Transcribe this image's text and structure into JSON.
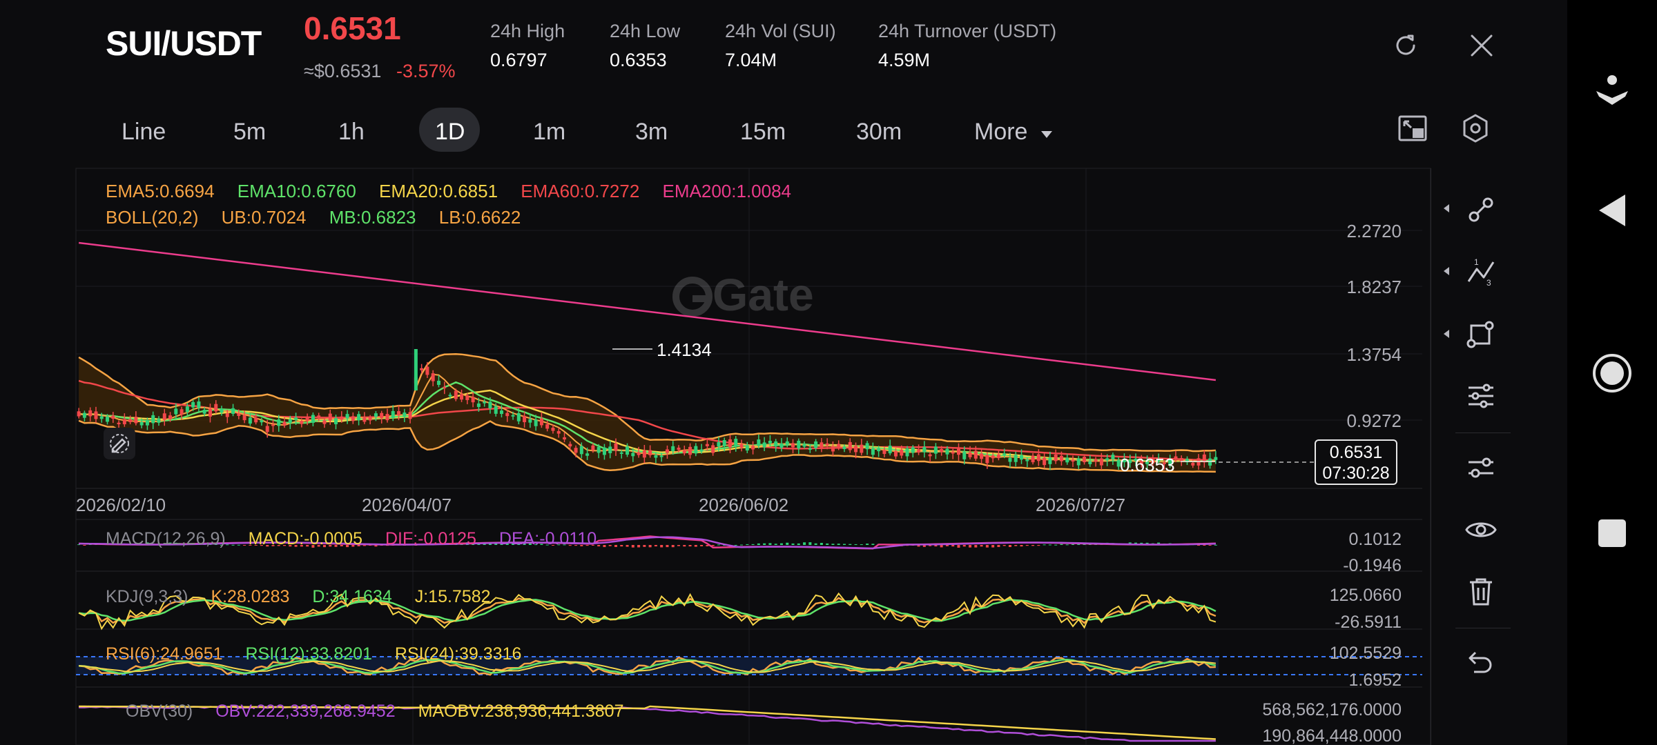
{
  "header": {
    "pair": "SUI/USDT",
    "last_price": "0.6531",
    "usd_price": "≈$0.6531",
    "change": "-3.57%",
    "stats": [
      {
        "label": "24h   High",
        "value": "0.6797"
      },
      {
        "label": "24h   Low",
        "value": "0.6353"
      },
      {
        "label": "24h   Vol (SUI)",
        "value": "7.04M"
      },
      {
        "label": "24h   Turnover (USDT)",
        "value": "4.59M"
      }
    ]
  },
  "timeframes": [
    "Line",
    "5m",
    "1h",
    "1D",
    "1m",
    "3m",
    "15m",
    "30m",
    "More"
  ],
  "active_timeframe": "1D",
  "indicators": {
    "ema": [
      {
        "text": "EMA5:0.6694",
        "color": "#f7a444"
      },
      {
        "text": "EMA10:0.6760",
        "color": "#5fe36a"
      },
      {
        "text": "EMA20:0.6851",
        "color": "#f5d54a"
      },
      {
        "text": "EMA60:0.7272",
        "color": "#f2474a"
      },
      {
        "text": "EMA200:1.0084",
        "color": "#ec3c8c"
      }
    ],
    "boll": [
      {
        "text": "BOLL(20,2)",
        "color": "#f7a444"
      },
      {
        "text": "UB:0.7024",
        "color": "#f7a444"
      },
      {
        "text": "MB:0.6823",
        "color": "#5fe36a"
      },
      {
        "text": "LB:0.6622",
        "color": "#f7a444"
      }
    ],
    "macd": [
      {
        "text": "MACD(12,26,9)",
        "color": "#8a8a92"
      },
      {
        "text": "MACD:-0.0005",
        "color": "#f5d54a"
      },
      {
        "text": "DIF:-0.0125",
        "color": "#ec3c8c"
      },
      {
        "text": "DEA:-0.0110",
        "color": "#b04fd9"
      }
    ],
    "kdj": [
      {
        "text": "KDJ(9,3,3)",
        "color": "#8a8a92"
      },
      {
        "text": "K:28.0283",
        "color": "#f7a444"
      },
      {
        "text": "D:34.1634",
        "color": "#5fe36a"
      },
      {
        "text": "J:15.7582",
        "color": "#f5d54a"
      }
    ],
    "rsi": [
      {
        "text": "RSI(6):24.9651",
        "color": "#f7a444"
      },
      {
        "text": "RSI(12):33.8201",
        "color": "#5fe36a"
      },
      {
        "text": "RSI(24):39.3316",
        "color": "#f5d54a"
      }
    ],
    "obv": [
      {
        "text": "OBV(30)",
        "color": "#8a8a92"
      },
      {
        "text": "OBV:222,339,268.9452",
        "color": "#b04fd9"
      },
      {
        "text": "MAOBV:238,936,441.3807",
        "color": "#f5d54a"
      }
    ]
  },
  "axes": {
    "main_y": [
      "2.2720",
      "1.8237",
      "1.3754",
      "0.9272"
    ],
    "x_dates": [
      "2026/02/10",
      "2026/04/07",
      "2026/06/02",
      "2026/07/27"
    ],
    "macd_y": [
      "0.1012",
      "-0.1946"
    ],
    "kdj_y": [
      "125.0660",
      "-26.5911"
    ],
    "rsi_y": [
      "102.5529",
      "1.6952"
    ],
    "obv_y": [
      "568,562,176.0000",
      "190,864,448.0000"
    ]
  },
  "annotations": {
    "high": "1.4134",
    "low": "0.6353",
    "current_price": "0.6531",
    "countdown": "07:30:28"
  },
  "watermark": "Gate",
  "colors": {
    "down": "#f2474a",
    "up": "#2fd07a",
    "background": "#0c0c0e"
  }
}
